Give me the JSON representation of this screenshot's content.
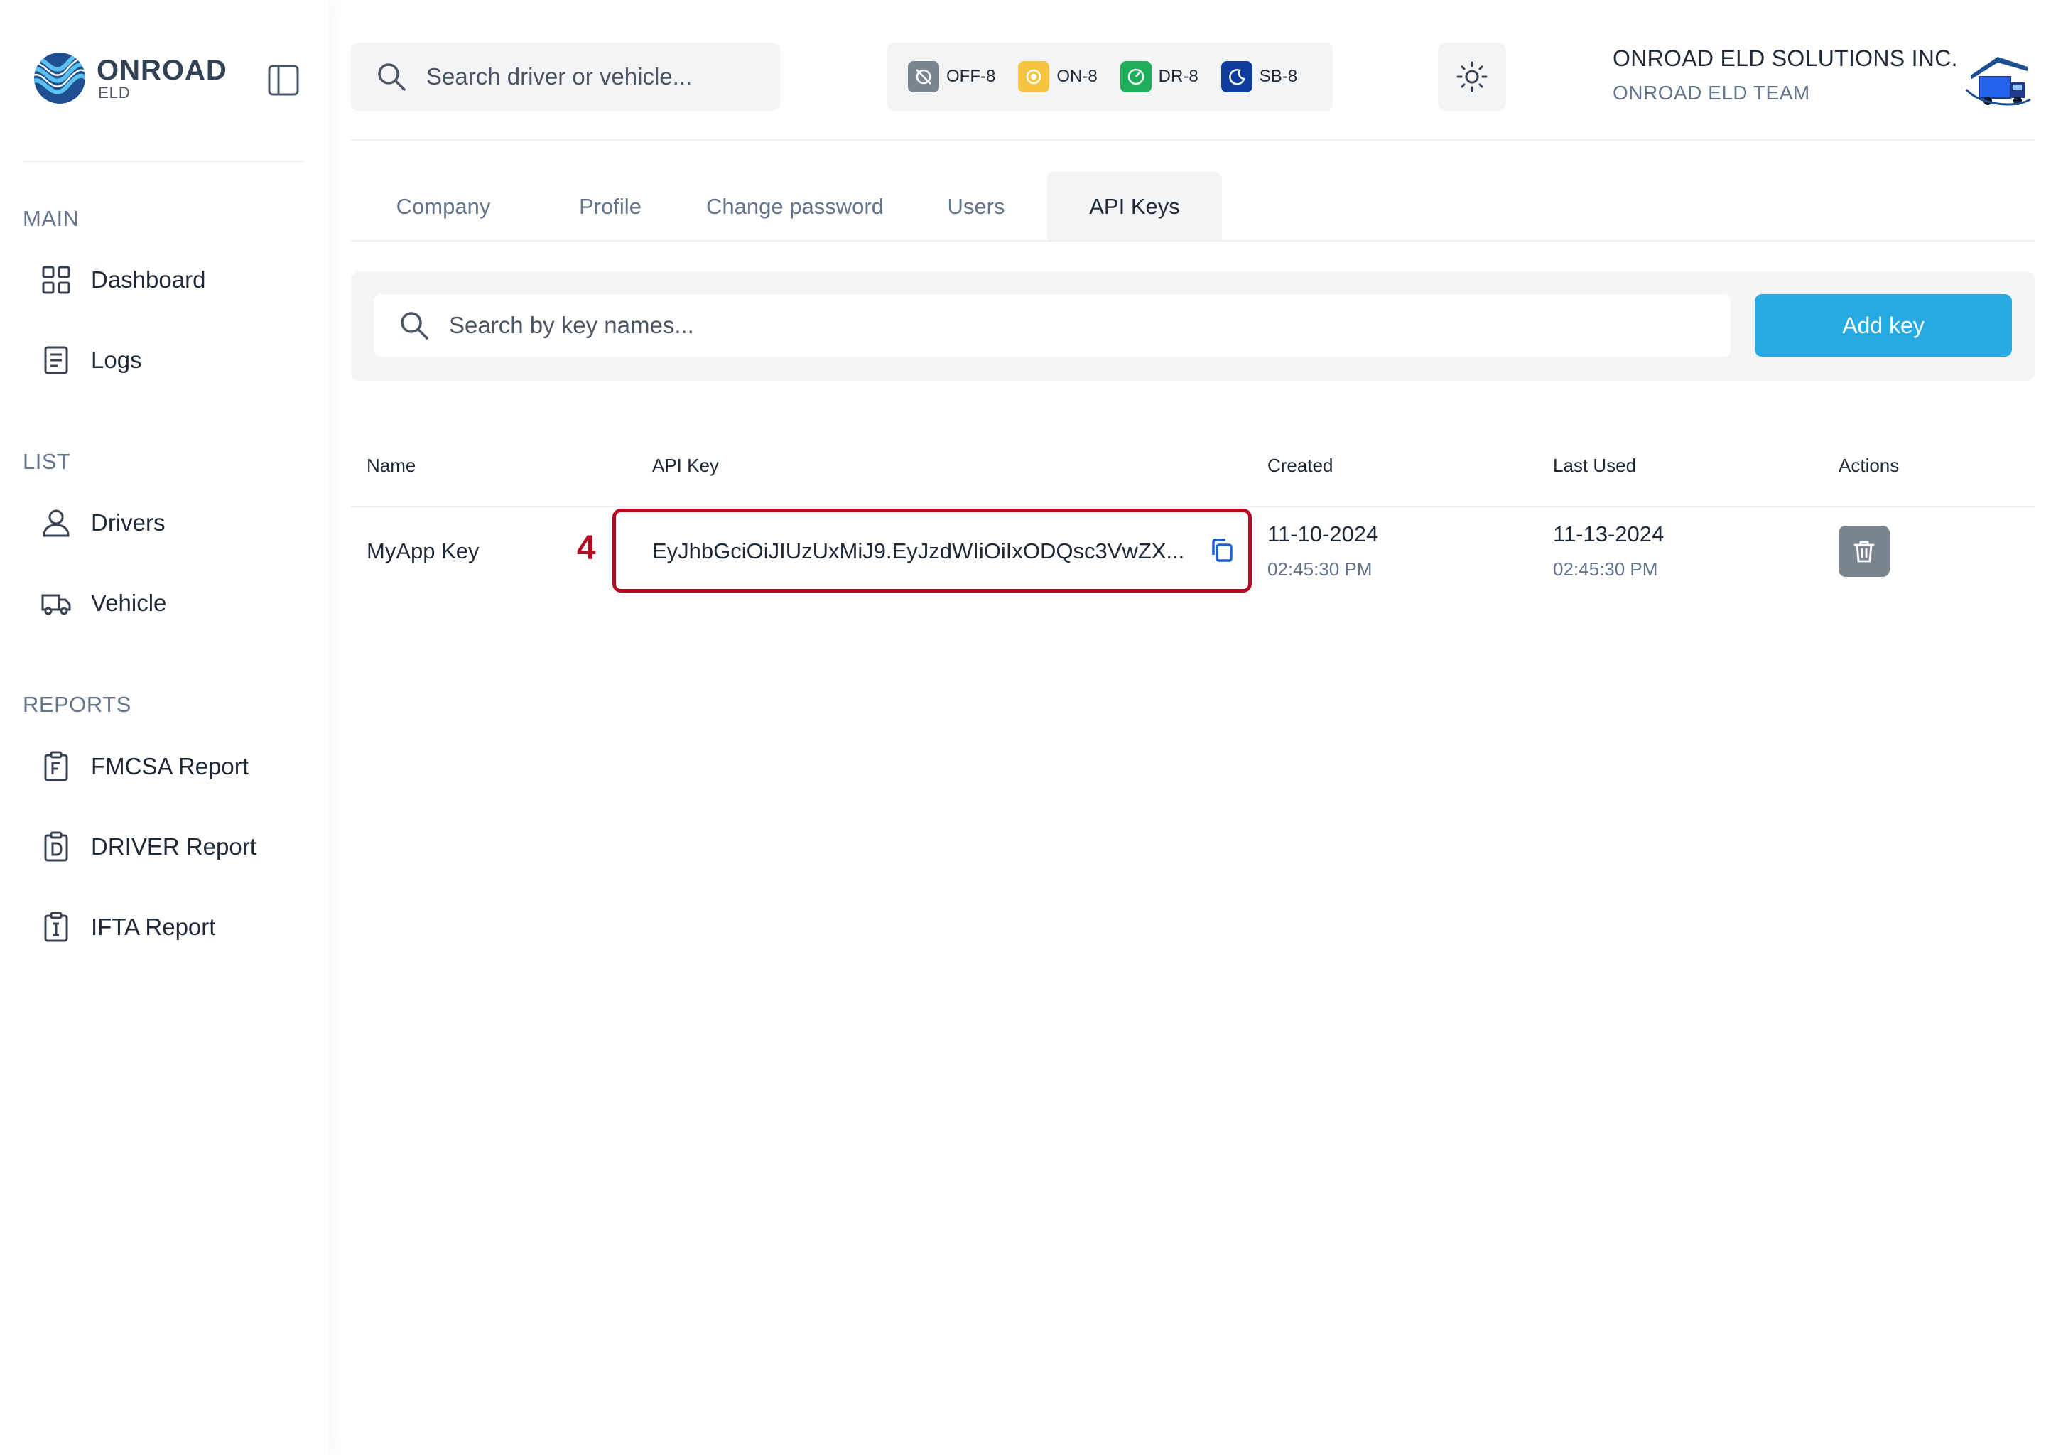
{
  "brand": {
    "name": "ONROAD",
    "sub": "ELD"
  },
  "sidebar": {
    "sections": [
      {
        "title": "MAIN",
        "items": [
          {
            "label": "Dashboard",
            "icon": "grid-icon"
          },
          {
            "label": "Logs",
            "icon": "document-icon"
          }
        ]
      },
      {
        "title": "LIST",
        "items": [
          {
            "label": "Drivers",
            "icon": "user-icon"
          },
          {
            "label": "Vehicle",
            "icon": "truck-icon"
          }
        ]
      },
      {
        "title": "REPORTS",
        "items": [
          {
            "label": "FMCSA Report",
            "icon": "clipboard-f-icon"
          },
          {
            "label": "DRIVER Report",
            "icon": "clipboard-d-icon"
          },
          {
            "label": "IFTA Report",
            "icon": "clipboard-i-icon"
          }
        ]
      }
    ]
  },
  "header": {
    "search_placeholder": "Search driver or vehicle...",
    "statuses": [
      {
        "label": "OFF-8",
        "color": "#7b8590",
        "icon": "off-duty-icon"
      },
      {
        "label": "ON-8",
        "color": "#f5c542",
        "icon": "on-duty-icon"
      },
      {
        "label": "DR-8",
        "color": "#1fae5b",
        "icon": "driving-icon"
      },
      {
        "label": "SB-8",
        "color": "#0d3b9e",
        "icon": "sleeper-icon"
      }
    ],
    "company_name": "ONROAD ELD SOLUTIONS INC.",
    "team_name": "ONROAD ELD TEAM"
  },
  "tabs": [
    {
      "label": "Company",
      "active": false
    },
    {
      "label": "Profile",
      "active": false
    },
    {
      "label": "Change password",
      "active": false
    },
    {
      "label": "Users",
      "active": false
    },
    {
      "label": "API Keys",
      "active": true
    }
  ],
  "toolbar": {
    "search_placeholder": "Search by key names...",
    "add_label": "Add key"
  },
  "table": {
    "columns": [
      "Name",
      "API Key",
      "Created",
      "Last Used",
      "Actions"
    ],
    "rows": [
      {
        "name": "MyApp Key",
        "api_key": "EyJhbGciOiJIUzUxMiJ9.EyJzdWIiOiIxODQsc3VwZX...",
        "created_date": "11-10-2024",
        "created_time": "02:45:30 PM",
        "last_used_date": "11-13-2024",
        "last_used_time": "02:45:30 PM"
      }
    ]
  },
  "annotation": {
    "step": "4",
    "color": "#b00d23"
  },
  "colors": {
    "accent": "#27a9e1",
    "delete": "#7b8590"
  }
}
